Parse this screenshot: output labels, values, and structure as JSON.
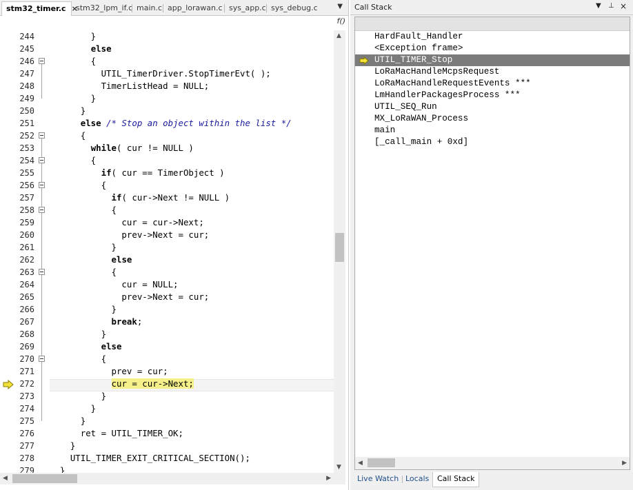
{
  "editor": {
    "tabs": [
      {
        "label": "stm32_timer.c",
        "active": true
      },
      {
        "label": "stm32_lpm_if.c"
      },
      {
        "label": "main.c"
      },
      {
        "label": "app_lorawan.c"
      },
      {
        "label": "sys_app.c"
      },
      {
        "label": "sys_debug.c"
      }
    ],
    "tab_close": "×",
    "tab_dropdown": "▼",
    "function_button": "f()",
    "current_line": "272",
    "lines": [
      {
        "n": "244",
        "code": [
          {
            "t": "        }"
          }
        ]
      },
      {
        "n": "245",
        "code": [
          {
            "t": "        "
          },
          {
            "t": "else",
            "c": "kw"
          }
        ]
      },
      {
        "n": "246",
        "code": [
          {
            "t": "        {"
          }
        ]
      },
      {
        "n": "247",
        "code": [
          {
            "t": "          UTIL_TimerDriver.StopTimerEvt( );"
          }
        ]
      },
      {
        "n": "248",
        "code": [
          {
            "t": "          TimerListHead = NULL;"
          }
        ]
      },
      {
        "n": "249",
        "code": [
          {
            "t": "        }"
          }
        ]
      },
      {
        "n": "250",
        "code": [
          {
            "t": "      }"
          }
        ]
      },
      {
        "n": "251",
        "code": [
          {
            "t": "      "
          },
          {
            "t": "else",
            "c": "kw"
          },
          {
            "t": " "
          },
          {
            "t": "/* Stop an object within the list */",
            "c": "cm"
          }
        ]
      },
      {
        "n": "252",
        "code": [
          {
            "t": "      {"
          }
        ]
      },
      {
        "n": "253",
        "code": [
          {
            "t": "        "
          },
          {
            "t": "while",
            "c": "kw"
          },
          {
            "t": "( cur != NULL )"
          }
        ]
      },
      {
        "n": "254",
        "code": [
          {
            "t": "        {"
          }
        ]
      },
      {
        "n": "255",
        "code": [
          {
            "t": "          "
          },
          {
            "t": "if",
            "c": "kw"
          },
          {
            "t": "( cur == TimerObject )"
          }
        ]
      },
      {
        "n": "256",
        "code": [
          {
            "t": "          {"
          }
        ]
      },
      {
        "n": "257",
        "code": [
          {
            "t": "            "
          },
          {
            "t": "if",
            "c": "kw"
          },
          {
            "t": "( cur->Next != NULL )"
          }
        ]
      },
      {
        "n": "258",
        "code": [
          {
            "t": "            {"
          }
        ]
      },
      {
        "n": "259",
        "code": [
          {
            "t": "              cur = cur->Next;"
          }
        ]
      },
      {
        "n": "260",
        "code": [
          {
            "t": "              prev->Next = cur;"
          }
        ]
      },
      {
        "n": "261",
        "code": [
          {
            "t": "            }"
          }
        ]
      },
      {
        "n": "262",
        "code": [
          {
            "t": "            "
          },
          {
            "t": "else",
            "c": "kw"
          }
        ]
      },
      {
        "n": "263",
        "code": [
          {
            "t": "            {"
          }
        ]
      },
      {
        "n": "264",
        "code": [
          {
            "t": "              cur = NULL;"
          }
        ]
      },
      {
        "n": "265",
        "code": [
          {
            "t": "              prev->Next = cur;"
          }
        ]
      },
      {
        "n": "266",
        "code": [
          {
            "t": "            }"
          }
        ]
      },
      {
        "n": "267",
        "code": [
          {
            "t": "            "
          },
          {
            "t": "break",
            "c": "kw"
          },
          {
            "t": ";"
          }
        ]
      },
      {
        "n": "268",
        "code": [
          {
            "t": "          }"
          }
        ]
      },
      {
        "n": "269",
        "code": [
          {
            "t": "          "
          },
          {
            "t": "else",
            "c": "kw"
          }
        ]
      },
      {
        "n": "270",
        "code": [
          {
            "t": "          {"
          }
        ]
      },
      {
        "n": "271",
        "code": [
          {
            "t": "            prev = cur;"
          }
        ]
      },
      {
        "n": "272",
        "code": [
          {
            "t": "            "
          },
          {
            "t": "cur = cur->Next;",
            "c": "hl"
          }
        ]
      },
      {
        "n": "273",
        "code": [
          {
            "t": "          }"
          }
        ]
      },
      {
        "n": "274",
        "code": [
          {
            "t": "        }"
          }
        ]
      },
      {
        "n": "275",
        "code": [
          {
            "t": "      }"
          }
        ]
      },
      {
        "n": "276",
        "code": [
          {
            "t": "      ret = UTIL_TIMER_OK;"
          }
        ]
      },
      {
        "n": "277",
        "code": [
          {
            "t": "    }"
          }
        ]
      },
      {
        "n": "278",
        "code": [
          {
            "t": "    UTIL_TIMER_EXIT_CRITICAL_SECTION();"
          }
        ]
      },
      {
        "n": "279",
        "code": [
          {
            "t": "  }"
          }
        ]
      }
    ],
    "fold_markers": [
      "246",
      "252",
      "254",
      "256",
      "258",
      "263",
      "270"
    ]
  },
  "call_stack": {
    "title": "Call Stack",
    "controls": {
      "dropdown": "▼",
      "pin": "⊥",
      "close": "×"
    },
    "frames": [
      {
        "label": "HardFault_Handler"
      },
      {
        "label": "<Exception frame>"
      },
      {
        "label": "UTIL_TIMER_Stop",
        "current": true
      },
      {
        "label": "LoRaMacHandleMcpsRequest"
      },
      {
        "label": "LoRaMacHandleRequestEvents ***"
      },
      {
        "label": "LmHandlerPackagesProcess ***"
      },
      {
        "label": "UTIL_SEQ_Run"
      },
      {
        "label": "MX_LoRaWAN_Process"
      },
      {
        "label": "main"
      },
      {
        "label": "[_call_main + 0xd]"
      }
    ]
  },
  "bottom_tabs": [
    {
      "label": "Live Watch"
    },
    {
      "label": "Locals"
    },
    {
      "label": "Call Stack",
      "active": true
    }
  ],
  "colors": {
    "current_line_highlight": "#f5f08a",
    "selected_frame_bg": "#7b7b7b",
    "pc_arrow_fill": "#f3e23a",
    "comment": "#1a1a9e"
  },
  "icons": {
    "pc_arrow": "arrow-right-icon",
    "frame_arrow": "arrow-right-icon"
  }
}
